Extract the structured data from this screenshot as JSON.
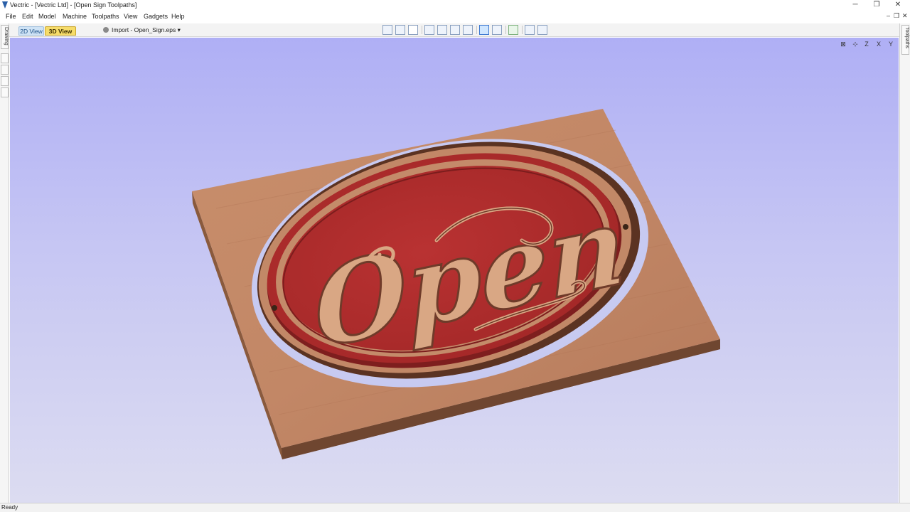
{
  "window": {
    "title": "Vectric - [Vectric Ltd] - [Open Sign Toolpaths]"
  },
  "menu": [
    "File",
    "Edit",
    "Model",
    "Machine",
    "Toolpaths",
    "View",
    "Gadgets",
    "Help"
  ],
  "tabs": {
    "view2d": "2D View",
    "view3d": "3D View"
  },
  "toolbar": {
    "import_label": "Import - Open_Sign.eps"
  },
  "side_tabs": {
    "left": "Drawing",
    "right": "Toolpaths"
  },
  "model": {
    "sign_text": "Open"
  },
  "status": {
    "text": "Ready"
  },
  "colors": {
    "accent_tab": "#f6dc6a",
    "wood": "#c58a65",
    "paint_red": "#b52c2c",
    "viewport_top": "#afaff5",
    "viewport_bottom": "#dcdcf1"
  }
}
